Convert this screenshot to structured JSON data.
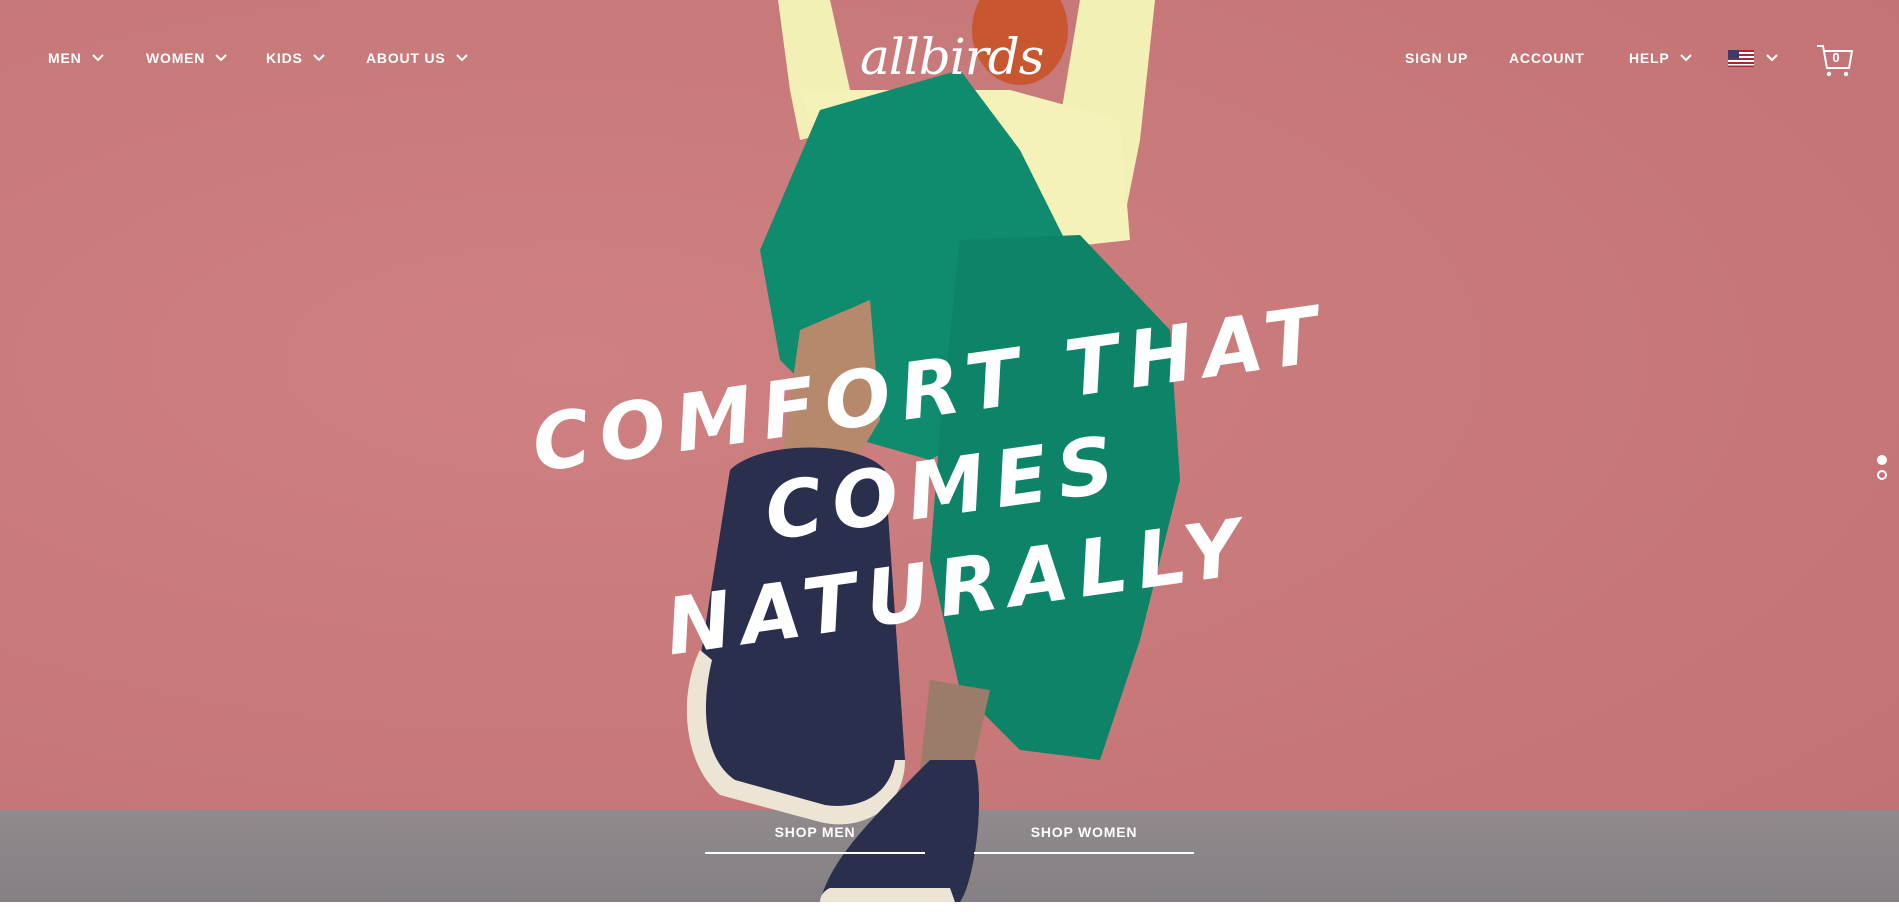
{
  "brand": {
    "logo_text": "allbirds"
  },
  "nav": {
    "left": [
      {
        "label": "MEN"
      },
      {
        "label": "WOMEN"
      },
      {
        "label": "KIDS"
      },
      {
        "label": "ABOUT US"
      }
    ],
    "right": [
      {
        "label": "SIGN UP"
      },
      {
        "label": "ACCOUNT"
      },
      {
        "label": "HELP"
      }
    ],
    "locale_icon": "us-flag-icon",
    "cart_count": "0"
  },
  "hero": {
    "headline_line1": "COMFORT THAT",
    "headline_line2": "COMES NATURALLY",
    "cta_men": "SHOP MEN",
    "cta_women": "SHOP WOMEN",
    "carousel_total": 2,
    "carousel_active": 1
  },
  "colors": {
    "background": "#c97a7b",
    "floor": "#8a8588",
    "text": "#ffffff",
    "pants": "#0e8a6c",
    "sweater": "#f4f2b8",
    "shoe": "#2b3050"
  }
}
